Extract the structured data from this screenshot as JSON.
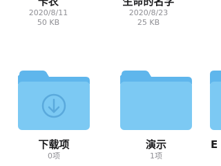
{
  "files": [
    {
      "name": "卡农",
      "date": "2020/8/11",
      "size": "50 KB"
    },
    {
      "name": "生命的名字",
      "date": "2020/8/23",
      "size": "25 KB"
    }
  ],
  "folders": [
    {
      "name": "下载项",
      "count": "0项",
      "icon": "download-arrow-icon"
    },
    {
      "name": "演示",
      "count": "1项"
    },
    {
      "name": "E"
    }
  ],
  "colors": {
    "folder_body": "#7cc9f3",
    "folder_tab": "#5fb6ec",
    "folder_glyph": "#5aa9dc",
    "name_text": "#1c1c1e",
    "meta_text": "#8e8e93"
  }
}
